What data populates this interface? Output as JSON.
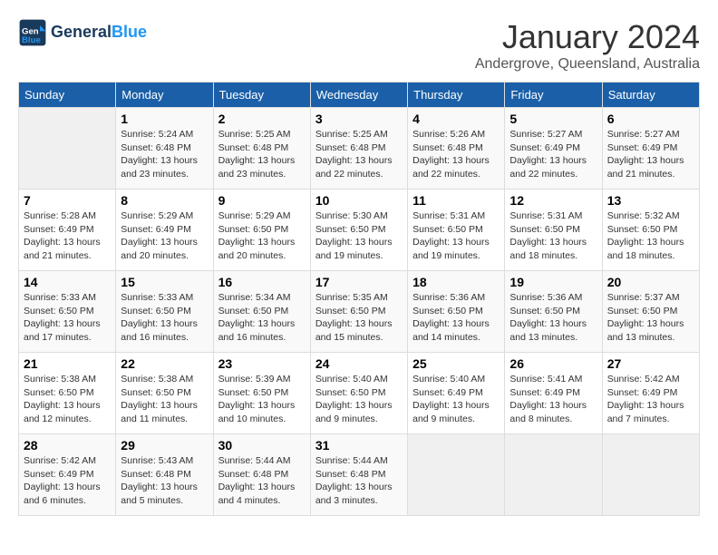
{
  "header": {
    "logo_line1": "General",
    "logo_line2": "Blue",
    "month": "January 2024",
    "location": "Andergrove, Queensland, Australia"
  },
  "weekdays": [
    "Sunday",
    "Monday",
    "Tuesday",
    "Wednesday",
    "Thursday",
    "Friday",
    "Saturday"
  ],
  "weeks": [
    [
      {
        "day": "",
        "sunrise": "",
        "sunset": "",
        "daylight": ""
      },
      {
        "day": "1",
        "sunrise": "Sunrise: 5:24 AM",
        "sunset": "Sunset: 6:48 PM",
        "daylight": "Daylight: 13 hours and 23 minutes."
      },
      {
        "day": "2",
        "sunrise": "Sunrise: 5:25 AM",
        "sunset": "Sunset: 6:48 PM",
        "daylight": "Daylight: 13 hours and 23 minutes."
      },
      {
        "day": "3",
        "sunrise": "Sunrise: 5:25 AM",
        "sunset": "Sunset: 6:48 PM",
        "daylight": "Daylight: 13 hours and 22 minutes."
      },
      {
        "day": "4",
        "sunrise": "Sunrise: 5:26 AM",
        "sunset": "Sunset: 6:48 PM",
        "daylight": "Daylight: 13 hours and 22 minutes."
      },
      {
        "day": "5",
        "sunrise": "Sunrise: 5:27 AM",
        "sunset": "Sunset: 6:49 PM",
        "daylight": "Daylight: 13 hours and 22 minutes."
      },
      {
        "day": "6",
        "sunrise": "Sunrise: 5:27 AM",
        "sunset": "Sunset: 6:49 PM",
        "daylight": "Daylight: 13 hours and 21 minutes."
      }
    ],
    [
      {
        "day": "7",
        "sunrise": "Sunrise: 5:28 AM",
        "sunset": "Sunset: 6:49 PM",
        "daylight": "Daylight: 13 hours and 21 minutes."
      },
      {
        "day": "8",
        "sunrise": "Sunrise: 5:29 AM",
        "sunset": "Sunset: 6:49 PM",
        "daylight": "Daylight: 13 hours and 20 minutes."
      },
      {
        "day": "9",
        "sunrise": "Sunrise: 5:29 AM",
        "sunset": "Sunset: 6:50 PM",
        "daylight": "Daylight: 13 hours and 20 minutes."
      },
      {
        "day": "10",
        "sunrise": "Sunrise: 5:30 AM",
        "sunset": "Sunset: 6:50 PM",
        "daylight": "Daylight: 13 hours and 19 minutes."
      },
      {
        "day": "11",
        "sunrise": "Sunrise: 5:31 AM",
        "sunset": "Sunset: 6:50 PM",
        "daylight": "Daylight: 13 hours and 19 minutes."
      },
      {
        "day": "12",
        "sunrise": "Sunrise: 5:31 AM",
        "sunset": "Sunset: 6:50 PM",
        "daylight": "Daylight: 13 hours and 18 minutes."
      },
      {
        "day": "13",
        "sunrise": "Sunrise: 5:32 AM",
        "sunset": "Sunset: 6:50 PM",
        "daylight": "Daylight: 13 hours and 18 minutes."
      }
    ],
    [
      {
        "day": "14",
        "sunrise": "Sunrise: 5:33 AM",
        "sunset": "Sunset: 6:50 PM",
        "daylight": "Daylight: 13 hours and 17 minutes."
      },
      {
        "day": "15",
        "sunrise": "Sunrise: 5:33 AM",
        "sunset": "Sunset: 6:50 PM",
        "daylight": "Daylight: 13 hours and 16 minutes."
      },
      {
        "day": "16",
        "sunrise": "Sunrise: 5:34 AM",
        "sunset": "Sunset: 6:50 PM",
        "daylight": "Daylight: 13 hours and 16 minutes."
      },
      {
        "day": "17",
        "sunrise": "Sunrise: 5:35 AM",
        "sunset": "Sunset: 6:50 PM",
        "daylight": "Daylight: 13 hours and 15 minutes."
      },
      {
        "day": "18",
        "sunrise": "Sunrise: 5:36 AM",
        "sunset": "Sunset: 6:50 PM",
        "daylight": "Daylight: 13 hours and 14 minutes."
      },
      {
        "day": "19",
        "sunrise": "Sunrise: 5:36 AM",
        "sunset": "Sunset: 6:50 PM",
        "daylight": "Daylight: 13 hours and 13 minutes."
      },
      {
        "day": "20",
        "sunrise": "Sunrise: 5:37 AM",
        "sunset": "Sunset: 6:50 PM",
        "daylight": "Daylight: 13 hours and 13 minutes."
      }
    ],
    [
      {
        "day": "21",
        "sunrise": "Sunrise: 5:38 AM",
        "sunset": "Sunset: 6:50 PM",
        "daylight": "Daylight: 13 hours and 12 minutes."
      },
      {
        "day": "22",
        "sunrise": "Sunrise: 5:38 AM",
        "sunset": "Sunset: 6:50 PM",
        "daylight": "Daylight: 13 hours and 11 minutes."
      },
      {
        "day": "23",
        "sunrise": "Sunrise: 5:39 AM",
        "sunset": "Sunset: 6:50 PM",
        "daylight": "Daylight: 13 hours and 10 minutes."
      },
      {
        "day": "24",
        "sunrise": "Sunrise: 5:40 AM",
        "sunset": "Sunset: 6:50 PM",
        "daylight": "Daylight: 13 hours and 9 minutes."
      },
      {
        "day": "25",
        "sunrise": "Sunrise: 5:40 AM",
        "sunset": "Sunset: 6:49 PM",
        "daylight": "Daylight: 13 hours and 9 minutes."
      },
      {
        "day": "26",
        "sunrise": "Sunrise: 5:41 AM",
        "sunset": "Sunset: 6:49 PM",
        "daylight": "Daylight: 13 hours and 8 minutes."
      },
      {
        "day": "27",
        "sunrise": "Sunrise: 5:42 AM",
        "sunset": "Sunset: 6:49 PM",
        "daylight": "Daylight: 13 hours and 7 minutes."
      }
    ],
    [
      {
        "day": "28",
        "sunrise": "Sunrise: 5:42 AM",
        "sunset": "Sunset: 6:49 PM",
        "daylight": "Daylight: 13 hours and 6 minutes."
      },
      {
        "day": "29",
        "sunrise": "Sunrise: 5:43 AM",
        "sunset": "Sunset: 6:48 PM",
        "daylight": "Daylight: 13 hours and 5 minutes."
      },
      {
        "day": "30",
        "sunrise": "Sunrise: 5:44 AM",
        "sunset": "Sunset: 6:48 PM",
        "daylight": "Daylight: 13 hours and 4 minutes."
      },
      {
        "day": "31",
        "sunrise": "Sunrise: 5:44 AM",
        "sunset": "Sunset: 6:48 PM",
        "daylight": "Daylight: 13 hours and 3 minutes."
      },
      {
        "day": "",
        "sunrise": "",
        "sunset": "",
        "daylight": ""
      },
      {
        "day": "",
        "sunrise": "",
        "sunset": "",
        "daylight": ""
      },
      {
        "day": "",
        "sunrise": "",
        "sunset": "",
        "daylight": ""
      }
    ]
  ]
}
